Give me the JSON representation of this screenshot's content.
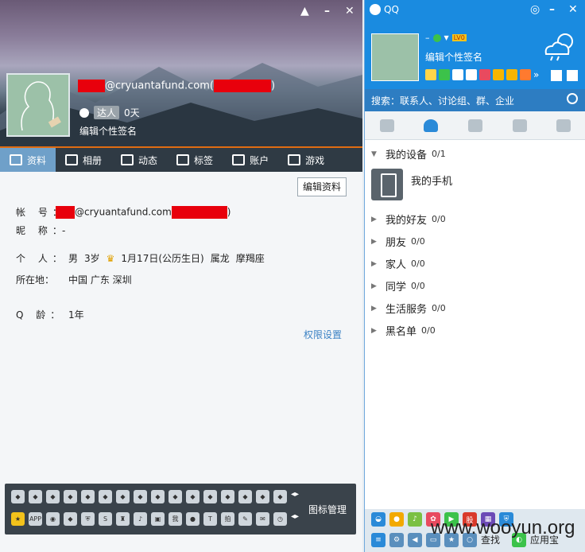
{
  "profile": {
    "account_text": "@cryuantafund.com(",
    "account_close": ")",
    "talent_badge": "达人",
    "days": "0天",
    "signature": "编辑个性签名"
  },
  "tabs": [
    {
      "label": "资料",
      "icon": "profile-card-icon"
    },
    {
      "label": "相册",
      "icon": "photo-album-icon"
    },
    {
      "label": "动态",
      "icon": "feed-list-icon"
    },
    {
      "label": "标签",
      "icon": "bookmark-icon"
    },
    {
      "label": "账户",
      "icon": "wallet-icon"
    },
    {
      "label": "游戏",
      "icon": "game-icon"
    }
  ],
  "edit_button": "编辑资料",
  "info": {
    "account_label": "帐  号：",
    "account_value": "@cryuantafund.com",
    "account_close": ")",
    "nickname_label": "昵  称：",
    "nickname_value": "-",
    "personal_label": "个  人：",
    "gender": "男",
    "age": "3岁",
    "birthday": "1月17日(公历生日)",
    "zodiac": "属龙",
    "constellation": "摩羯座",
    "location_label": "所在地：",
    "location_value": "中国 广东 深圳",
    "qage_label": "Q  龄：",
    "qage_value": "1年"
  },
  "permission_link": "权限设置",
  "icon_manager": "图标管理",
  "bottom_icon_labels": [
    "APP",
    "我",
    "拍"
  ],
  "qq": {
    "title": "QQ",
    "status_dash": "–",
    "level_badge": "LV0",
    "signature": "编辑个性签名",
    "search_placeholder": "搜索：联系人、讨论组、群、企业",
    "groups": [
      {
        "name": "我的设备",
        "count": "0/1",
        "expanded": true
      },
      {
        "name": "我的好友",
        "count": "0/0",
        "expanded": false
      },
      {
        "name": "朋友",
        "count": "0/0",
        "expanded": false
      },
      {
        "name": "家人",
        "count": "0/0",
        "expanded": false
      },
      {
        "name": "同学",
        "count": "0/0",
        "expanded": false
      },
      {
        "name": "生活服务",
        "count": "0/0",
        "expanded": false
      },
      {
        "name": "黑名单",
        "count": "0/0",
        "expanded": false
      }
    ],
    "device": "我的手机",
    "tab_icons": [
      "chat-icon",
      "contacts-icon",
      "favorites-icon",
      "group-icon",
      "phone-icon"
    ],
    "bottom_labels": {
      "find": "查找",
      "app_store": "应用宝",
      "stock": "股"
    }
  },
  "watermark": "www.wooyun.org",
  "colors": {
    "qq_blue": "#1a8be0",
    "link": "#3b82c4",
    "tab_accent": "#e06c12",
    "redaction": "#e8000c"
  }
}
